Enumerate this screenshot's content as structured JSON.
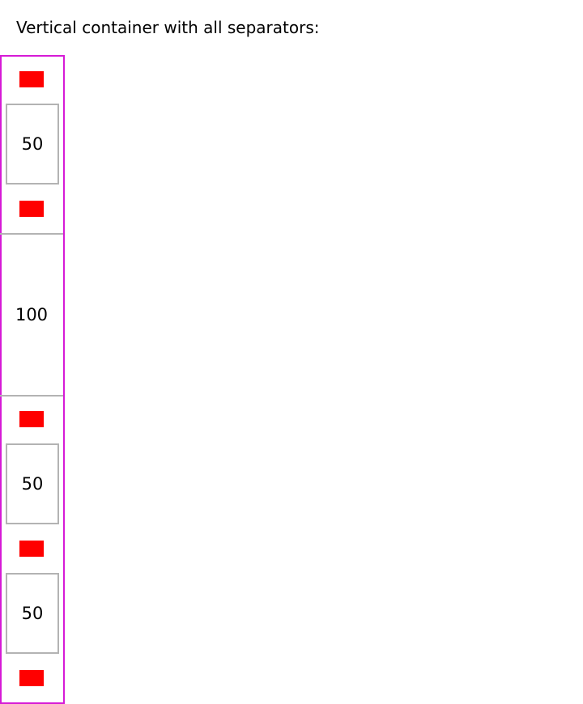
{
  "heading": "Vertical container with all separators:",
  "colors": {
    "container_border": "#d61ad6",
    "separator": "#ff0000",
    "item_border": "#b3b3b3"
  },
  "items": [
    {
      "label": "50"
    },
    {
      "label": "100"
    },
    {
      "label": "50"
    },
    {
      "label": "50"
    }
  ]
}
